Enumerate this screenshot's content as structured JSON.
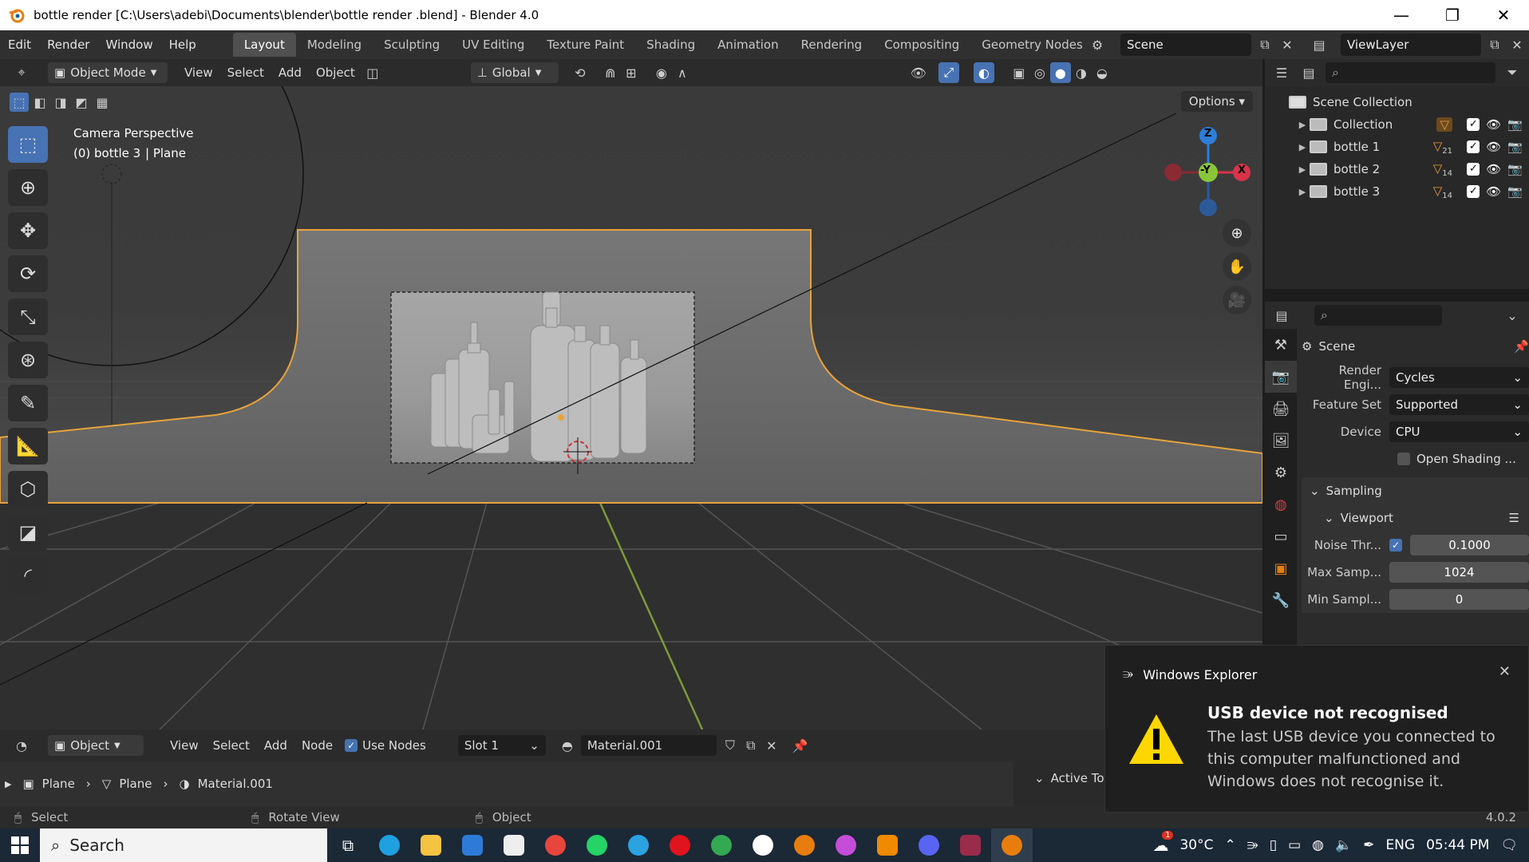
{
  "titlebar": {
    "title": "bottle render  [C:\\Users\\adebi\\Documents\\blender\\bottle render .blend] - Blender 4.0"
  },
  "menu": {
    "items": [
      "Edit",
      "Render",
      "Window",
      "Help"
    ],
    "workspaces": [
      "Layout",
      "Modeling",
      "Sculpting",
      "UV Editing",
      "Texture Paint",
      "Shading",
      "Animation",
      "Rendering",
      "Compositing",
      "Geometry Nodes"
    ],
    "active_workspace": "Layout",
    "scene": "Scene",
    "view_layer": "ViewLayer"
  },
  "viewport_header": {
    "mode": "Object Mode",
    "menus": [
      "View",
      "Select",
      "Add",
      "Object"
    ],
    "transform": "Global",
    "options": "Options"
  },
  "viewport": {
    "camera_label": "Camera Perspective",
    "object_label": "(0) bottle 3",
    "object_sub": "| Plane",
    "gizmo": {
      "z": "Z",
      "y": "-Y",
      "x": "X"
    }
  },
  "outliner": {
    "root": "Scene Collection",
    "items": [
      {
        "name": "Collection",
        "count": ""
      },
      {
        "name": "bottle 1",
        "count": "21"
      },
      {
        "name": "bottle 2",
        "count": "14"
      },
      {
        "name": "bottle 3",
        "count": "14"
      }
    ]
  },
  "properties": {
    "title": "Scene",
    "render_engine_label": "Render Engi...",
    "render_engine": "Cycles",
    "feature_set_label": "Feature Set",
    "feature_set": "Supported",
    "device_label": "Device",
    "device": "CPU",
    "open_shading": "Open Shading ...",
    "sampling": "Sampling",
    "viewport": "Viewport",
    "noise_label": "Noise Thr...",
    "noise": "0.1000",
    "max_label": "Max Samp...",
    "max": "1024",
    "min_label": "Min Sampl...",
    "min": "0"
  },
  "shader_header": {
    "object": "Object",
    "menus": [
      "View",
      "Select",
      "Add",
      "Node"
    ],
    "use_nodes": "Use Nodes",
    "slot": "Slot 1",
    "material": "Material.001",
    "active_tool": "Active To"
  },
  "breadcrumb": [
    "Plane",
    "Plane",
    "Material.001"
  ],
  "statusbar": {
    "select": "Select",
    "rotate": "Rotate View",
    "object": "Object",
    "version": "4.0.2"
  },
  "notification": {
    "app": "Windows Explorer",
    "title": "USB device not recognised",
    "body": "The last USB device you connected to this computer malfunctioned and Windows does not recognise it."
  },
  "taskbar": {
    "search": "Search",
    "weather_badge": "1",
    "temperature": "30°C",
    "language": "ENG",
    "time": "05:44 PM"
  },
  "colors": {
    "accent": "#4772b3",
    "selection_outline": "#e8a33b",
    "viewport_bg": "#3d3d3d"
  }
}
